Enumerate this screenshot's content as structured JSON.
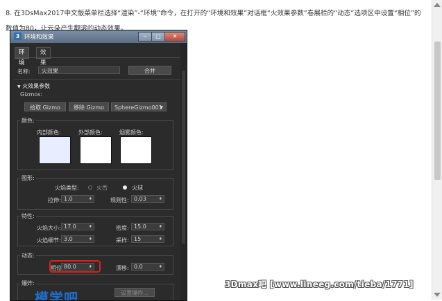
{
  "instruction": {
    "text": "8. 在3DsMax2017中文版菜单栏选择“渲染”-“环境”命令，在打开的“环境和效果”对话框“火效果参数”卷展栏的“动态”选项区中设置“相位”的数值为80，让云朵产生翻滚的动态效果。"
  },
  "dialog": {
    "icon_text": "3",
    "title": "环境和效果",
    "tabs": [
      "环境",
      "效果"
    ],
    "name_label": "名称:",
    "name_value": "火效果",
    "merge_button": "合并",
    "rollout": {
      "header": "火效果参数",
      "gizmos": {
        "label": "Gizmos:",
        "pick_button": "拾取 Gizmo",
        "remove_button": "移除 Gizmo",
        "selected": "SphereGizmo001"
      },
      "colors": {
        "label": "颜色:",
        "inner_label": "内部颜色:",
        "outer_label": "外部颜色:",
        "smoke_label": "烟雾颜色:",
        "inner_color": "#e8eeff",
        "outer_color": "#ffffff",
        "smoke_color": "#ffffff"
      },
      "shape": {
        "label": "图形:",
        "flame_type_label": "火焰类型:",
        "option_tendril": "火舌",
        "option_fireball": "火球",
        "selected": "火球",
        "stretch_label": "拉伸:",
        "stretch_value": "1.0",
        "regularity_label": "规则性:",
        "regularity_value": "0.03"
      },
      "characteristics": {
        "label": "特性:",
        "flame_size_label": "火焰大小:",
        "flame_size_value": "17.0",
        "density_label": "密度:",
        "density_value": "15.0",
        "flame_detail_label": "火焰细节:",
        "flame_detail_value": "3.0",
        "samples_label": "采样:",
        "samples_value": "15"
      },
      "motion": {
        "label": "动态:",
        "phase_label": "相位:",
        "phase_value": "80.0",
        "drift_label": "漂移:",
        "drift_value": "0.0"
      },
      "explosion": {
        "label": "爆炸:",
        "setup_button": "设置爆炸..."
      }
    },
    "logo_text": "模学吧"
  },
  "watermark": "3Dmax吧 [www.lineeg.com/tieba/1771]"
}
